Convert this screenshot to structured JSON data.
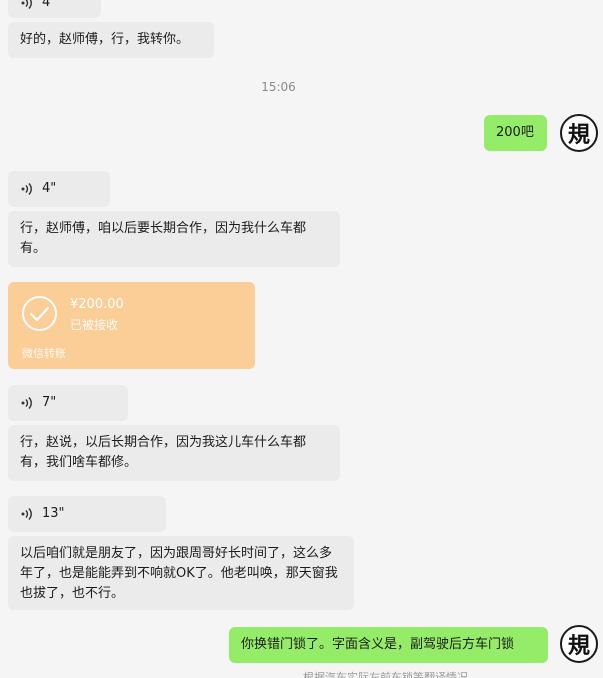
{
  "chat": {
    "top_voice_duration": "4\"",
    "messages": {
      "m1": "好的，赵师傅，行，我转你。",
      "time": "15:06",
      "m2_right": "200吧",
      "voice1": "4\"",
      "m3": "行，赵师傅，咱以后要长期合作，因为我什么车都有。",
      "transfer": {
        "amount": "¥200.00",
        "status": "已被接收",
        "footer": "微信转账"
      },
      "voice2": "7\"",
      "m4": "行，赵说，以后长期合作，因为我这儿车什么车都有，我们啥车都修。",
      "voice3": "13\"",
      "m5": "以后咱们就是朋友了，因为跟周哥好长时间了，这么多年了，也是能能弄到不响就OK了。他老叫唤，那天窗我也拔了，也不行。",
      "m6_right": "你换错门锁了。字面含义是，副驾驶后方车门锁",
      "bottom_cut": "根据汽车实际左前车锁等翻译情况"
    },
    "avatar_char": "規",
    "colors": {
      "background": "#f5f5f5",
      "bubble_left": "#ebebeb",
      "bubble_right": "#95ec69",
      "transfer": "#fbcd97"
    }
  }
}
